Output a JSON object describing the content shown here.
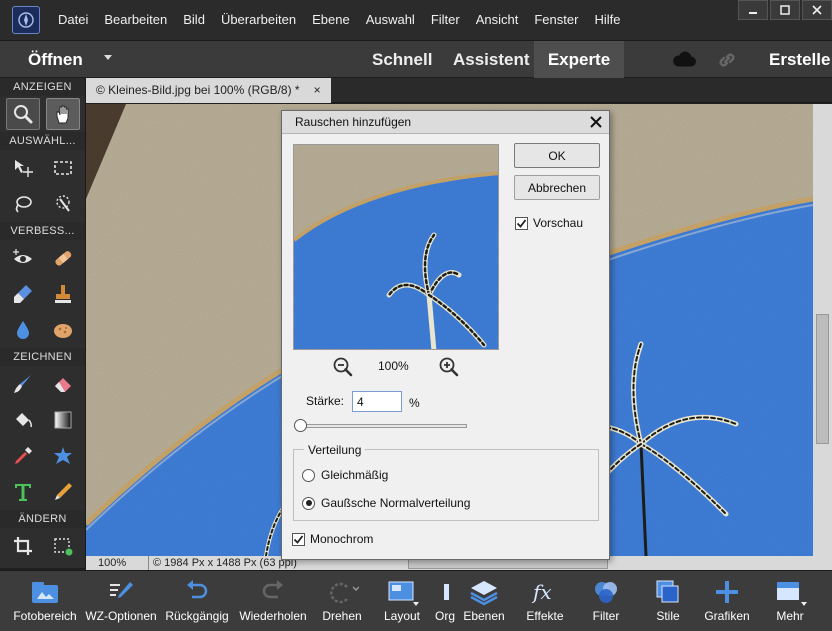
{
  "menubar": {
    "items": [
      "Datei",
      "Bearbeiten",
      "Bild",
      "Überarbeiten",
      "Ebene",
      "Auswahl",
      "Filter",
      "Ansicht",
      "Fenster",
      "Hilfe"
    ]
  },
  "modebar": {
    "open_label": "Öffnen",
    "tabs": [
      "Schnell",
      "Assistent",
      "Experte"
    ],
    "active_tab": "Experte",
    "create_label": "Erstelle"
  },
  "toolbar": {
    "sections": {
      "view": "ANZEIGEN",
      "select": "AUSWÄHL...",
      "enhance": "VERBESS...",
      "draw": "ZEICHNEN",
      "modify": "ÄNDERN"
    }
  },
  "document": {
    "tab_title": "© Kleines-Bild.jpg bei 100% (RGB/8) *",
    "tab_close": "×",
    "zoom": "100%",
    "info": "© 1984 Px x 1488 Px (63 ppi)"
  },
  "dialog": {
    "title": "Rauschen hinzufügen",
    "ok_label": "OK",
    "cancel_label": "Abbrechen",
    "preview_label": "Vorschau",
    "preview_checked": true,
    "zoom_percent": "100%",
    "amount_label": "Stärke:",
    "amount_value": "4",
    "amount_unit": "%",
    "distribution_label": "Verteilung",
    "uniform_label": "Gleichmäßig",
    "gaussian_label": "Gaußsche Normalverteilung",
    "distribution_selected": "gaussian",
    "monochrome_label": "Monochrom",
    "monochrome_checked": true
  },
  "bottombar": {
    "items": [
      "Fotobereich",
      "WZ-Optionen",
      "Rückgängig",
      "Wiederholen",
      "Drehen",
      "Layout",
      "Org",
      "Ebenen",
      "Effekte",
      "Filter",
      "Stile",
      "Grafiken",
      "Mehr"
    ]
  },
  "colors": {
    "sky": "#3f7ed8",
    "wall": "#b7ad95",
    "ui_dark": "#2e2e2e",
    "dialog_bg": "#f0f0f0",
    "accent_blue": "#2a64c8"
  }
}
